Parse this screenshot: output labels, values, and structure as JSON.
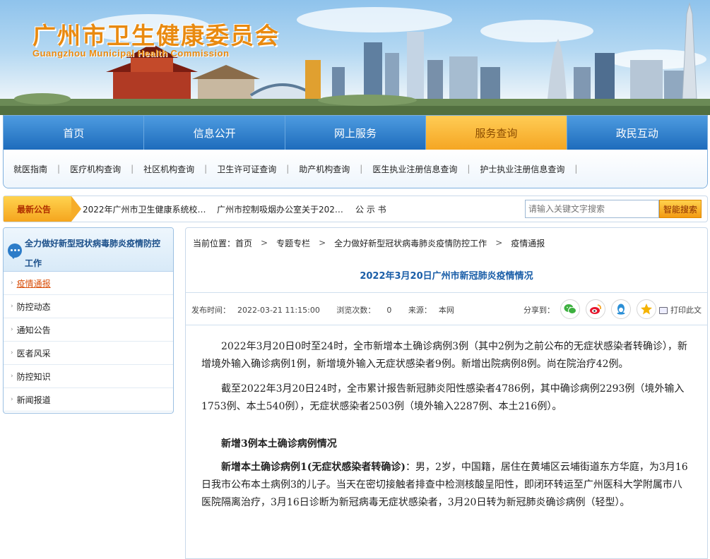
{
  "header": {
    "title_cn": "广州市卫生健康委员会",
    "title_en": "Guangzhou Municipal Health Commission"
  },
  "nav": {
    "main": [
      "首页",
      "信息公开",
      "网上服务",
      "服务查询",
      "政民互动"
    ],
    "active_index": 3,
    "sub": [
      "就医指南",
      "医疗机构查询",
      "社区机构查询",
      "卫生许可证查询",
      "助产机构查询",
      "医生执业注册信息查询",
      "护士执业注册信息查询"
    ]
  },
  "notice": {
    "label": "最新公告",
    "items": [
      "2022年广州市卫生健康系统校…",
      "广州市控制吸烟办公室关于202…",
      "公 示 书"
    ]
  },
  "search": {
    "placeholder": "请输入关键文字搜索",
    "button": "智能搜索"
  },
  "sidebar": {
    "title_line1": "全力做好新型冠状病毒肺炎疫情防控",
    "title_line2": "工作",
    "items": [
      "疫情通报",
      "防控动态",
      "通知公告",
      "医者风采",
      "防控知识",
      "新闻报道"
    ],
    "active_index": 0
  },
  "breadcrumb": {
    "prefix": "当前位置：",
    "items": [
      "首页",
      "专题专栏",
      "全力做好新型冠状病毒肺炎疫情防控工作",
      "疫情通报"
    ]
  },
  "article": {
    "title": "2022年3月20日广州市新冠肺炎疫情情况",
    "publish_label": "发布时间：",
    "publish_time": "2022-03-21 11:15:00",
    "views_label": "浏览次数：",
    "views": "0",
    "source_label": "来源：",
    "source": "本网",
    "share_label": "分享到：",
    "share_icons": [
      "wechat-icon",
      "weibo-icon",
      "qq-icon",
      "qzone-icon"
    ],
    "print_label": "打印此文",
    "p1": "2022年3月20日0时至24时，全市新增本土确诊病例3例（其中2例为之前公布的无症状感染者转确诊），新增境外输入确诊病例1例，新增境外输入无症状感染者9例。新增出院病例8例。尚在院治疗42例。",
    "p2": "截至2022年3月20日24时，全市累计报告新冠肺炎阳性感染者4786例，其中确诊病例2293例（境外输入1753例、本土540例），无症状感染者2503例（境外输入2287例、本土216例）。",
    "h1": "新增3例本土确诊病例情况",
    "case1_lead": "新增本土确诊病例1(无症状感染者转确诊)",
    "case1_text": "：男，2岁，中国籍，居住在黄埔区云埔街道东方华庭，为3月16日我市公布本土病例3的儿子。当天在密切接触者排查中检测核酸呈阳性，即闭环转运至广州医科大学附属市八医院隔离治疗，3月16日诊断为新冠病毒无症状感染者，3月20日转为新冠肺炎确诊病例（轻型）。"
  }
}
